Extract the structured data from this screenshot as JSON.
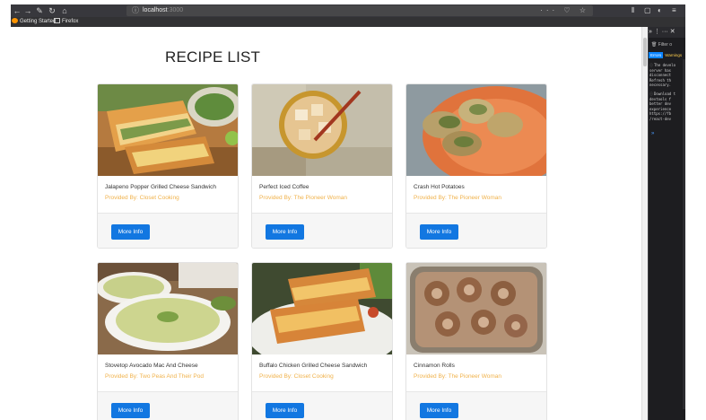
{
  "browser": {
    "url": "localhost",
    "url_port": ":3000",
    "bookmarks": [
      "Getting Started",
      "Firefox"
    ],
    "nav_icons": [
      "back-arrow-icon",
      "forward-arrow-icon",
      "tools-icon",
      "reload-icon",
      "home-icon"
    ],
    "page_actions": "··· ♡ ☆"
  },
  "page": {
    "title": "RECIPE LIST",
    "button_label": "More Info",
    "recipes": [
      {
        "name": "Jalapeno Popper Grilled Cheese Sandwich",
        "provider": "Provided By: Closet Cooking"
      },
      {
        "name": "Perfect Iced Coffee",
        "provider": "Provided By: The Pioneer Woman"
      },
      {
        "name": "Crash Hot Potatoes",
        "provider": "Provided By: The Pioneer Woman"
      },
      {
        "name": "Stovetop Avocado Mac And Cheese",
        "provider": "Provided By: Two Peas And Their Pod"
      },
      {
        "name": "Buffalo Chicken Grilled Cheese Sandwich",
        "provider": "Provided By: Closet Cooking"
      },
      {
        "name": "Cinnamon Rolls",
        "provider": "Provided By: The Pioneer Woman"
      }
    ]
  },
  "devtools": {
    "header": "» ⋮ ··· ✕",
    "filter_placeholder": "Filter o",
    "tabs": [
      "Errors",
      "Warnings"
    ],
    "messages": [
      "The develo\nserver has\ndisconnect\nRefresh th\nnecessary.",
      "Download t\ndevtools f\nbetter dev\nexperience\nhttps://fb\n/react-dev"
    ],
    "prompt": "»"
  },
  "colors": {
    "accent": "#1277e1",
    "provider": "#f0b24b",
    "chrome": "#38383d"
  }
}
